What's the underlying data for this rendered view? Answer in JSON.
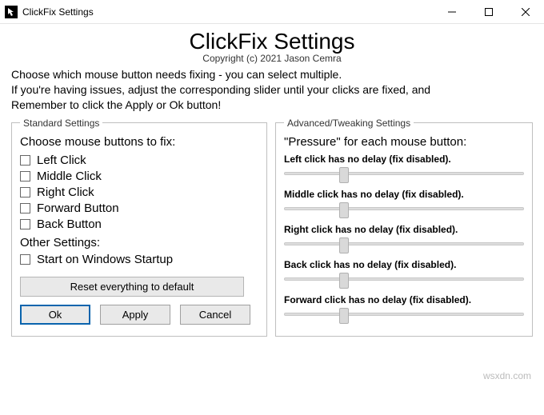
{
  "window": {
    "title": "ClickFix Settings"
  },
  "header": {
    "heading": "ClickFix Settings",
    "copyright": "Copyright (c) 2021 Jason Cemra",
    "intro_line1": "Choose which mouse button needs fixing - you can select multiple.",
    "intro_line2": "If you're having issues, adjust the corresponding slider until your clicks are fixed, and",
    "intro_line3": "Remember to click the Apply or Ok button!"
  },
  "groups": {
    "standard_legend": "Standard Settings",
    "advanced_legend": "Advanced/Tweaking Settings",
    "choose_label": "Choose mouse buttons to fix:",
    "other_label": "Other Settings:",
    "pressure_label": "\"Pressure\" for each mouse button:"
  },
  "checkboxes": {
    "left": "Left Click",
    "middle": "Middle Click",
    "right": "Right Click",
    "forward": "Forward Button",
    "back": "Back Button",
    "startup": "Start on Windows Startup"
  },
  "sliders": {
    "left": {
      "label": "Left click has no delay (fix disabled).",
      "percent": 25
    },
    "middle": {
      "label": "Middle click has no delay (fix disabled).",
      "percent": 25
    },
    "right": {
      "label": "Right click has no delay (fix disabled).",
      "percent": 25
    },
    "back": {
      "label": "Back click has no delay (fix disabled).",
      "percent": 25
    },
    "forward": {
      "label": "Forward click has no delay (fix disabled).",
      "percent": 25
    }
  },
  "buttons": {
    "reset": "Reset everything to default",
    "ok": "Ok",
    "apply": "Apply",
    "cancel": "Cancel"
  },
  "watermark": "wsxdn.com"
}
